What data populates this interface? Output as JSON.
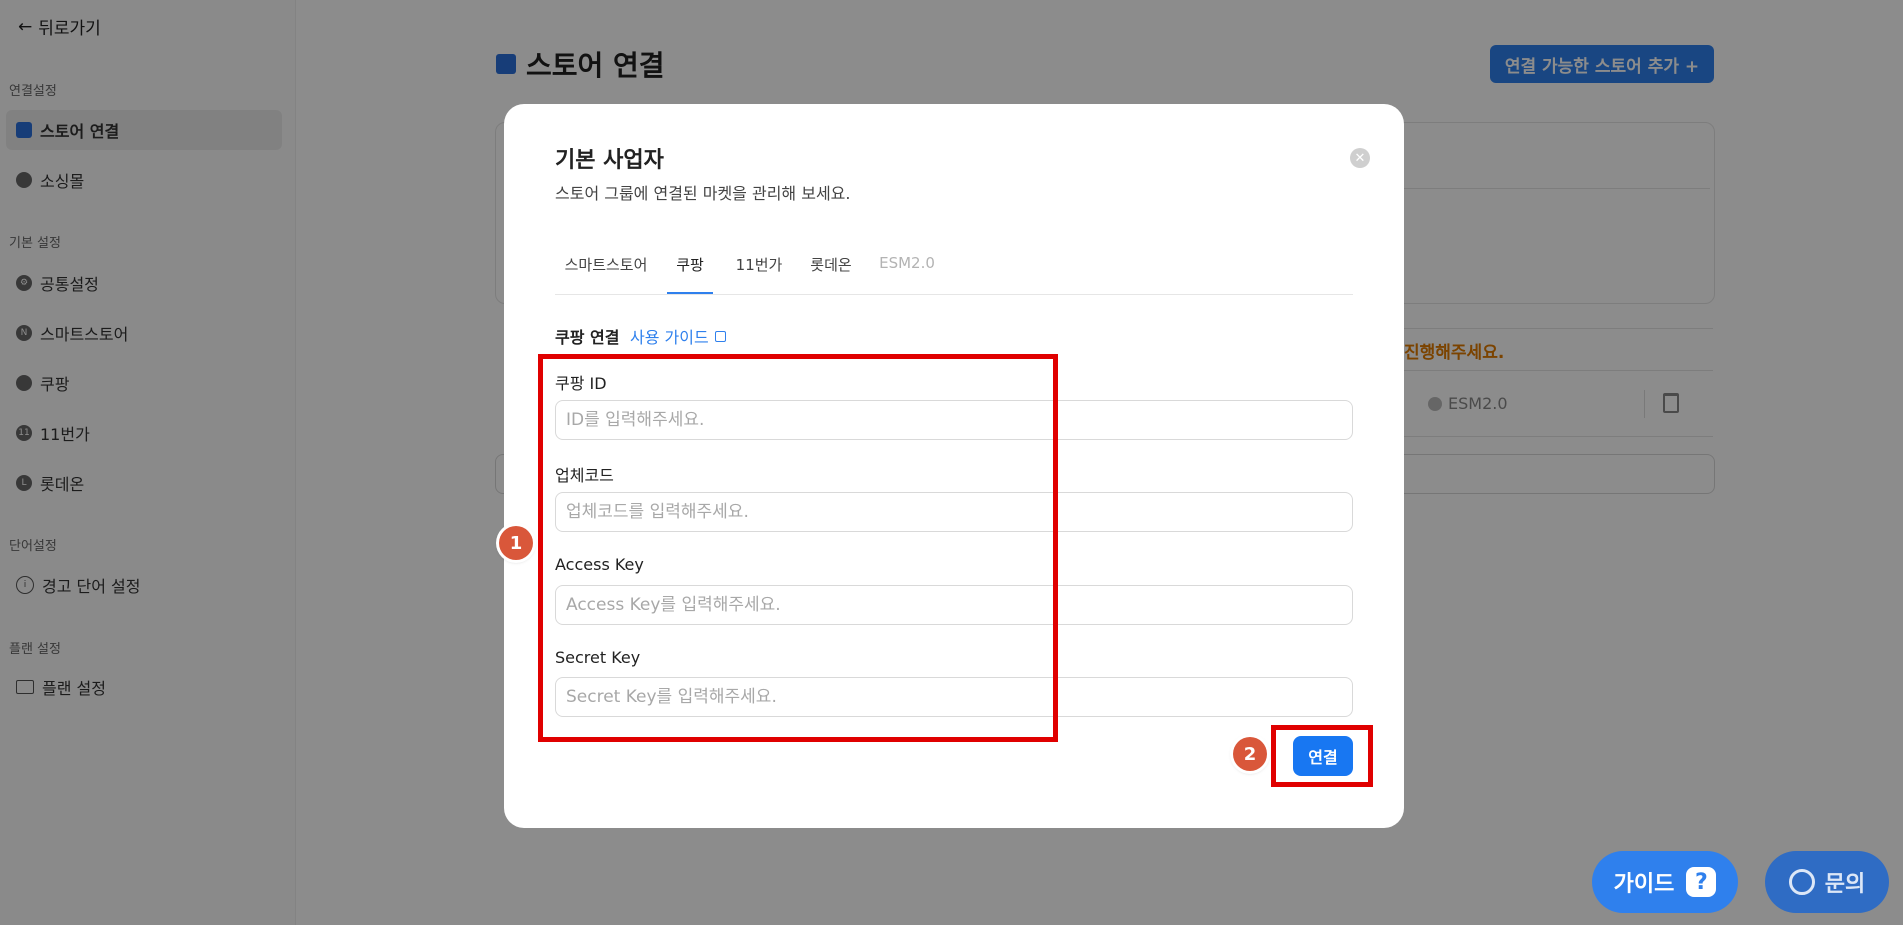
{
  "sidebar": {
    "back_label": "뒤로가기",
    "sections": [
      {
        "title": "연결설정",
        "items": [
          {
            "label": "스토어 연결",
            "icon": "store-icon",
            "active": true
          },
          {
            "label": "소싱몰",
            "icon": "sourcing-icon"
          }
        ]
      },
      {
        "title": "기본 설정",
        "items": [
          {
            "label": "공통설정",
            "icon": "gear-icon"
          },
          {
            "label": "스마트스토어",
            "icon": "smartstore-icon"
          },
          {
            "label": "쿠팡",
            "icon": "coupang-icon"
          },
          {
            "label": "11번가",
            "icon": "11st-icon"
          },
          {
            "label": "롯데온",
            "icon": "lotteon-icon"
          }
        ]
      },
      {
        "title": "단어설정",
        "items": [
          {
            "label": "경고 단어 설정",
            "icon": "info-icon"
          }
        ]
      },
      {
        "title": "플랜 설정",
        "items": [
          {
            "label": "플랜 설정",
            "icon": "card-icon"
          }
        ]
      }
    ]
  },
  "page": {
    "title": "스토어 연결",
    "add_store_label": "연결 가능한 스토어 추가 +",
    "warning_text": "진행해주세요.",
    "esm_chip": "ESM2.0"
  },
  "modal": {
    "title": "기본 사업자",
    "subtitle": "스토어 그룹에 연결된 마켓을 관리해 보세요.",
    "tabs": [
      {
        "label": "스마트스토어"
      },
      {
        "label": "쿠팡",
        "active": true
      },
      {
        "label": "11번가"
      },
      {
        "label": "롯데온"
      },
      {
        "label": "ESM2.0",
        "disabled": true
      }
    ],
    "section_title": "쿠팡 연결",
    "guide_link": "사용 가이드",
    "fields": [
      {
        "label": "쿠팡 ID",
        "placeholder": "ID를 입력해주세요.",
        "value": ""
      },
      {
        "label": "업체코드",
        "placeholder": "업체코드를 입력해주세요.",
        "value": ""
      },
      {
        "label": "Access Key",
        "placeholder": "Access Key를 입력해주세요.",
        "value": ""
      },
      {
        "label": "Secret Key",
        "placeholder": "Secret Key를 입력해주세요.",
        "value": ""
      }
    ],
    "connect_label": "연결",
    "close_icon": "close-icon"
  },
  "fab": {
    "guide_label": "가이드",
    "guide_glyph": "?",
    "inquiry_label": "문의"
  },
  "annotations": {
    "marker_1": "1",
    "marker_2": "2",
    "highlight_color": "#e00000",
    "marker_color": "#d9573a"
  },
  "colors": {
    "accent": "#2f80ed",
    "primary_button": "#1877f2",
    "warning": "#e07b00"
  }
}
